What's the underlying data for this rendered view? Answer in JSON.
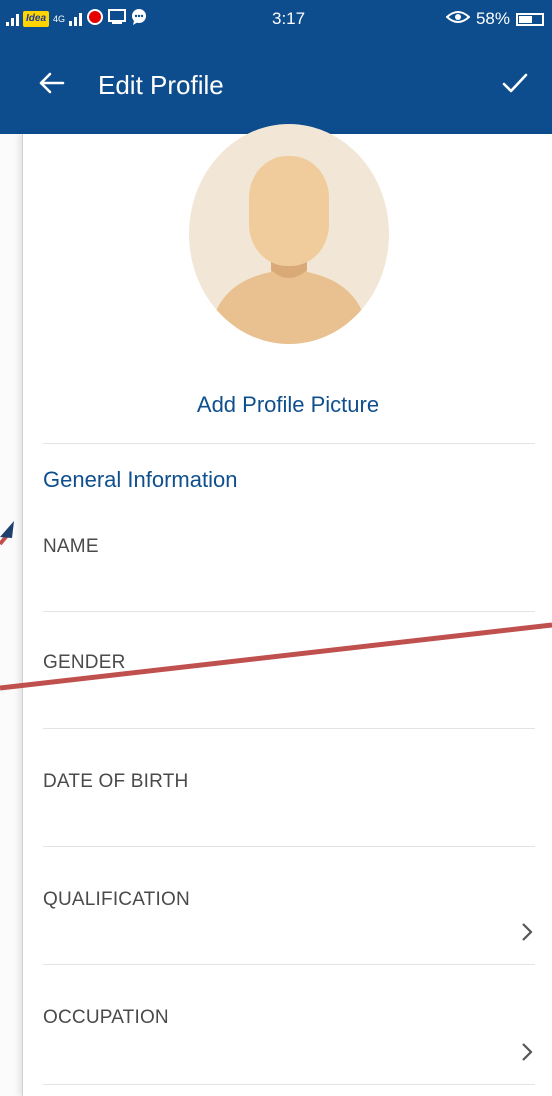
{
  "status_bar": {
    "carrier": "Idea",
    "network": "4G",
    "time": "3:17",
    "battery_percent": "58%",
    "battery_level": 0.58
  },
  "app_bar": {
    "title": "Edit Profile",
    "back_icon": "arrow-left-icon",
    "save_icon": "checkmark-icon"
  },
  "profile": {
    "avatar_icon": "default-avatar-icon",
    "add_picture_label": "Add Profile Picture"
  },
  "section": {
    "title": "General Information"
  },
  "fields": [
    {
      "label": "NAME",
      "value": ""
    },
    {
      "label": "GENDER",
      "value": ""
    },
    {
      "label": "DATE OF BIRTH",
      "value": ""
    },
    {
      "label": "QUALIFICATION",
      "value": ""
    },
    {
      "label": "OCCUPATION",
      "value": ""
    }
  ],
  "colors": {
    "primary": "#0d4d8e",
    "link": "#0f4f8e",
    "annotation": "#c0504d",
    "avatar_bg": "#f2e6d6",
    "avatar_skin": "#f0cb9b"
  }
}
